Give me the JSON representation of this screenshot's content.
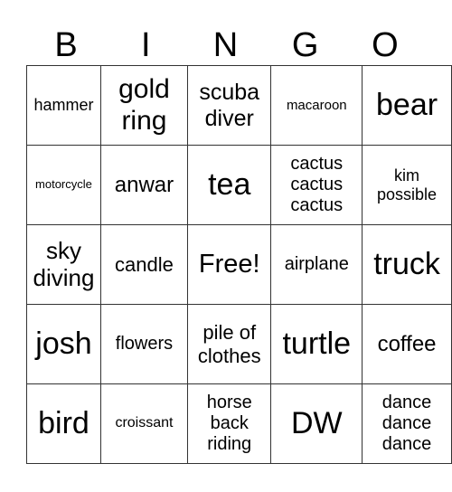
{
  "header": [
    "B",
    "I",
    "N",
    "G",
    "O"
  ],
  "rows": [
    [
      "hammer",
      "gold ring",
      "scuba diver",
      "macaroon",
      "bear"
    ],
    [
      "motorcycle",
      "anwar",
      "tea",
      "cactus cactus cactus",
      "kim possible"
    ],
    [
      "sky diving",
      "candle",
      "Free!",
      "airplane",
      "truck"
    ],
    [
      "josh",
      "flowers",
      "pile of clothes",
      "turtle",
      "coffee"
    ],
    [
      "bird",
      "croissant",
      "horse back riding",
      "DW",
      "dance dance dance"
    ]
  ]
}
